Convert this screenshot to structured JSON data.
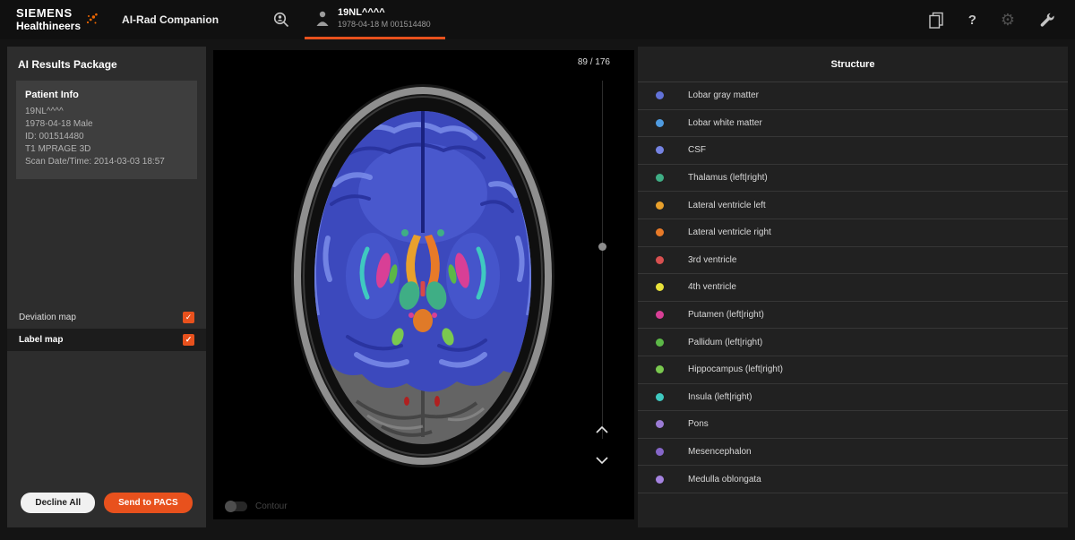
{
  "topbar": {
    "brand_line1": "SIEMENS",
    "brand_line2": "Healthineers",
    "app_title": "AI-Rad Companion",
    "patient_tab": {
      "name": "19NL^^^^",
      "details": "1978-04-18 M 001514480"
    },
    "icons": {
      "help_glyph": "?",
      "gear_glyph": "⚙"
    }
  },
  "sidebar": {
    "title": "AI Results Package",
    "patient_info": {
      "title": "Patient Info",
      "lines": [
        "19NL^^^^",
        "1978-04-18 Male",
        "ID: 001514480",
        "T1 MPRAGE 3D",
        "Scan Date/Time: 2014-03-03 18:57"
      ]
    },
    "maps": [
      {
        "label": "Deviation map",
        "check_glyph": "✓"
      },
      {
        "label": "Label map",
        "check_glyph": "✓"
      }
    ],
    "buttons": {
      "decline": "Decline All",
      "send": "Send to PACS"
    }
  },
  "viewer": {
    "slice_counter": "89 / 176",
    "contour_label": "Contour"
  },
  "structures": {
    "header": "Structure",
    "items": [
      {
        "label": "Lobar gray matter",
        "color": "#6272d8"
      },
      {
        "label": "Lobar white matter",
        "color": "#4f9be0"
      },
      {
        "label": "CSF",
        "color": "#7583e2"
      },
      {
        "label": "Thalamus (left|right)",
        "color": "#3fae85"
      },
      {
        "label": "Lateral ventricle left",
        "color": "#e8a02c"
      },
      {
        "label": "Lateral ventricle right",
        "color": "#e87a28"
      },
      {
        "label": "3rd ventricle",
        "color": "#d85050"
      },
      {
        "label": "4th ventricle",
        "color": "#e8e23a"
      },
      {
        "label": "Putamen (left|right)",
        "color": "#d83f96"
      },
      {
        "label": "Pallidum (left|right)",
        "color": "#5cb847"
      },
      {
        "label": "Hippocampus (left|right)",
        "color": "#7ac94f"
      },
      {
        "label": "Insula (left|right)",
        "color": "#3fc9c0"
      },
      {
        "label": "Pons",
        "color": "#9b7bd4"
      },
      {
        "label": "Mesencephalon",
        "color": "#8566c8"
      },
      {
        "label": "Medulla oblongata",
        "color": "#a583e0"
      }
    ]
  },
  "colors": {
    "accent_orange": "#e8511d"
  }
}
